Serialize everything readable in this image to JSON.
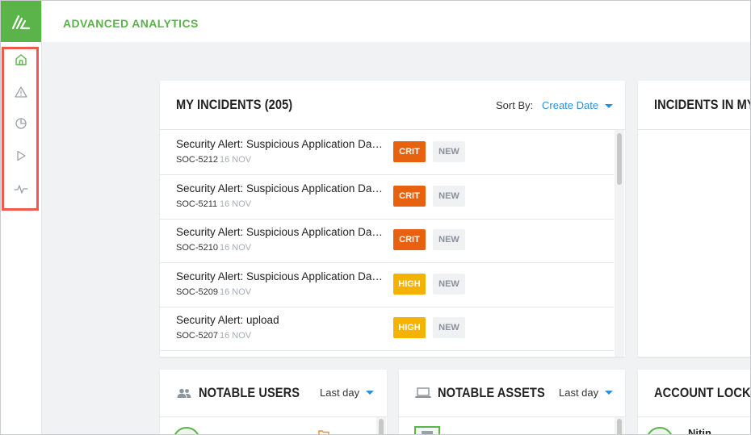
{
  "app": {
    "title": "ADVANCED ANALYTICS"
  },
  "sidebar": {
    "items": [
      {
        "name": "home",
        "icon": "home-icon",
        "active": true
      },
      {
        "name": "alerts",
        "icon": "warning-icon",
        "active": false
      },
      {
        "name": "reports",
        "icon": "pie-chart-icon",
        "active": false
      },
      {
        "name": "playbooks",
        "icon": "play-icon",
        "active": false
      },
      {
        "name": "activity",
        "icon": "pulse-icon",
        "active": false
      }
    ]
  },
  "colors": {
    "brand": "#5ab449",
    "crit": "#e8610f",
    "high": "#f5b301",
    "link": "#2b8fd8",
    "highlight": "#ee5b4d"
  },
  "incidents": {
    "title": "MY INCIDENTS (205)",
    "sort_label": "Sort By:",
    "sort_value": "Create Date",
    "rows": [
      {
        "title": "Security Alert: Suspicious Application Data Access",
        "id": "SOC-5212",
        "date": "16 NOV",
        "severity": "CRIT",
        "status": "NEW"
      },
      {
        "title": "Security Alert: Suspicious Application Data Access",
        "id": "SOC-5211",
        "date": "16 NOV",
        "severity": "CRIT",
        "status": "NEW"
      },
      {
        "title": "Security Alert: Suspicious Application Data Access",
        "id": "SOC-5210",
        "date": "16 NOV",
        "severity": "CRIT",
        "status": "NEW"
      },
      {
        "title": "Security Alert: Suspicious Application Data Access",
        "id": "SOC-5209",
        "date": "16 NOV",
        "severity": "HIGH",
        "status": "NEW"
      },
      {
        "title": "Security Alert: upload",
        "id": "SOC-5207",
        "date": "16 NOV",
        "severity": "HIGH",
        "status": "NEW"
      }
    ]
  },
  "queue": {
    "title": "INCIDENTS IN MY QUEUE"
  },
  "notable_users": {
    "title": "NOTABLE USERS",
    "period": "Last day",
    "icon": "users-icon"
  },
  "notable_assets": {
    "title": "NOTABLE ASSETS",
    "period": "Last day",
    "icon": "laptop-icon"
  },
  "lockouts": {
    "title": "ACCOUNT LOCKOUTS",
    "first_user": "Nitin"
  }
}
